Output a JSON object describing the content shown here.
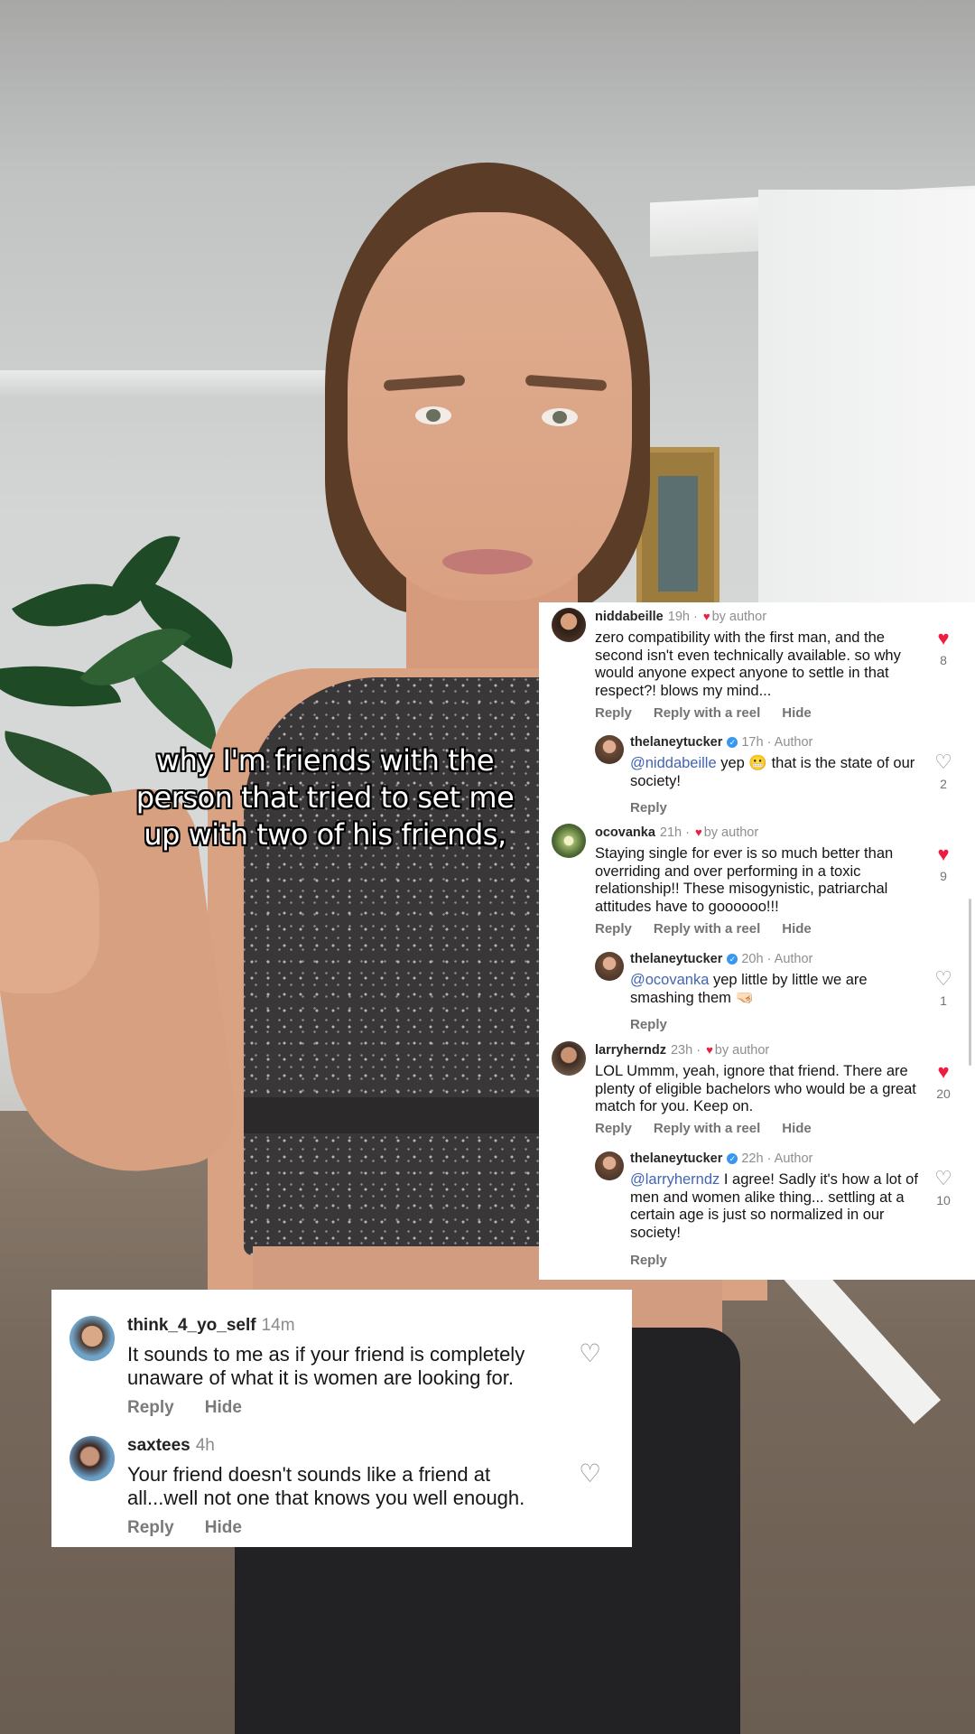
{
  "video": {
    "caption": "why I'm friends with the person that tried to set me up with two of his friends,"
  },
  "ig_comments": {
    "actions": {
      "reply": "Reply",
      "reply_reel": "Reply with a reel",
      "hide": "Hide"
    },
    "items": [
      {
        "user": "niddabeille",
        "time": "19h",
        "tag": "by author",
        "text": "zero compatibility with the first man, and the second isn't even technically available. so why would anyone expect anyone to settle in that respect?! blows my mind...",
        "likes": "8",
        "liked": true
      },
      {
        "user": "thelaneytucker",
        "time": "17h",
        "tag": "Author",
        "verified": true,
        "mention": "@niddabeille",
        "text": "yep 😬 that is the state of our society!",
        "likes": "2",
        "liked": false
      },
      {
        "user": "ocovanka",
        "time": "21h",
        "tag": "by author",
        "text": "Staying single for ever is so much better than overriding and over performing in a toxic relationship!! These misogynistic, patriarchal attitudes have to goooooo!!!",
        "likes": "9",
        "liked": true
      },
      {
        "user": "thelaneytucker",
        "time": "20h",
        "tag": "Author",
        "verified": true,
        "mention": "@ocovanka",
        "text": "yep little by little we are smashing them 🤜🏻",
        "likes": "1",
        "liked": false
      },
      {
        "user": "larryherndz",
        "time": "23h",
        "tag": "by author",
        "text": "LOL Ummm, yeah, ignore that friend. There are plenty of eligible bachelors who would be a great match for you. Keep on.",
        "likes": "20",
        "liked": true
      },
      {
        "user": "thelaneytucker",
        "time": "22h",
        "tag": "Author",
        "verified": true,
        "mention": "@larryherndz",
        "text": "I agree! Sadly it's how a lot of men and women alike thing... settling at a certain age is just so normalized in our society!",
        "likes": "10",
        "liked": false
      }
    ]
  },
  "tt_comments": {
    "actions": {
      "reply": "Reply",
      "hide": "Hide"
    },
    "items": [
      {
        "user": "think_4_yo_self",
        "time": "14m",
        "text": "It sounds to me as if your friend is completely unaware of what it is women are looking for."
      },
      {
        "user": "saxtees",
        "time": "4h",
        "text": "Your friend doesn't sounds like a friend at all...well not one that knows you well enough."
      }
    ]
  },
  "colors": {
    "like_red": "#ed1c40",
    "mention_blue": "#4264b3",
    "verified_blue": "#3897f0"
  },
  "icons": {
    "like_filled": "heart-filled-icon",
    "like_outline": "heart-outline-icon",
    "verified": "verified-badge-icon"
  }
}
